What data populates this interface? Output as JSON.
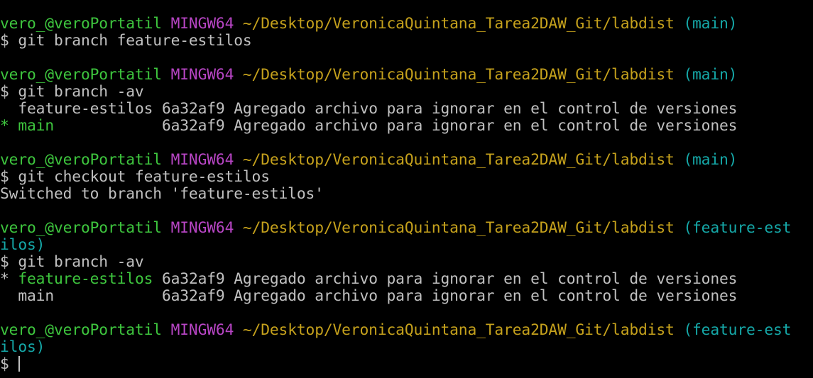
{
  "prompts": [
    {
      "user": "vero_@veroPortatil",
      "host": "MINGW64",
      "path": "~/Desktop/VeronicaQuintana_Tarea2DAW_Git/labdist",
      "branch": "(main)",
      "command": "$ git branch feature-estilos"
    },
    {
      "user": "vero_@veroPortatil",
      "host": "MINGW64",
      "path": "~/Desktop/VeronicaQuintana_Tarea2DAW_Git/labdist",
      "branch": "(main)",
      "command": "$ git branch -av"
    },
    {
      "user": "vero_@veroPortatil",
      "host": "MINGW64",
      "path": "~/Desktop/VeronicaQuintana_Tarea2DAW_Git/labdist",
      "branch": "(main)",
      "command": "$ git checkout feature-estilos"
    },
    {
      "user": "vero_@veroPortatil",
      "host": "MINGW64",
      "path": "~/Desktop/VeronicaQuintana_Tarea2DAW_Git/labdist",
      "branch": "(feature-est",
      "branch_wrap": "ilos)",
      "command": "$ git branch -av"
    },
    {
      "user": "vero_@veroPortatil",
      "host": "MINGW64",
      "path": "~/Desktop/VeronicaQuintana_Tarea2DAW_Git/labdist",
      "branch": "(feature-est",
      "branch_wrap": "ilos)",
      "command": "$"
    }
  ],
  "outputs": {
    "branch_list_1": [
      {
        "marker": " ",
        "name": "feature-estilos",
        "pad": " ",
        "hash": "6a32af9",
        "message": "Agregado archivo para ignorar en el control de versiones"
      },
      {
        "marker": "*",
        "name": "main",
        "pad": "            ",
        "hash": "6a32af9",
        "message": "Agregado archivo para ignorar en el control de versiones"
      }
    ],
    "checkout_message": "Switched to branch 'feature-estilos'",
    "branch_list_2": [
      {
        "marker": "*",
        "name": "feature-estilos",
        "pad": " ",
        "hash": "6a32af9",
        "message": "Agregado archivo para ignorar en el control de versiones"
      },
      {
        "marker": " ",
        "name": "main",
        "pad": "            ",
        "hash": "6a32af9",
        "message": "Agregado archivo para ignorar en el control de versiones"
      }
    ]
  },
  "colors": {
    "background": "#000000",
    "text": "#c0c0c0",
    "user": "#3ec63e",
    "host": "#b745c4",
    "path": "#c5a11c",
    "branch": "#15a8a8",
    "current_branch": "#3ec63e"
  }
}
